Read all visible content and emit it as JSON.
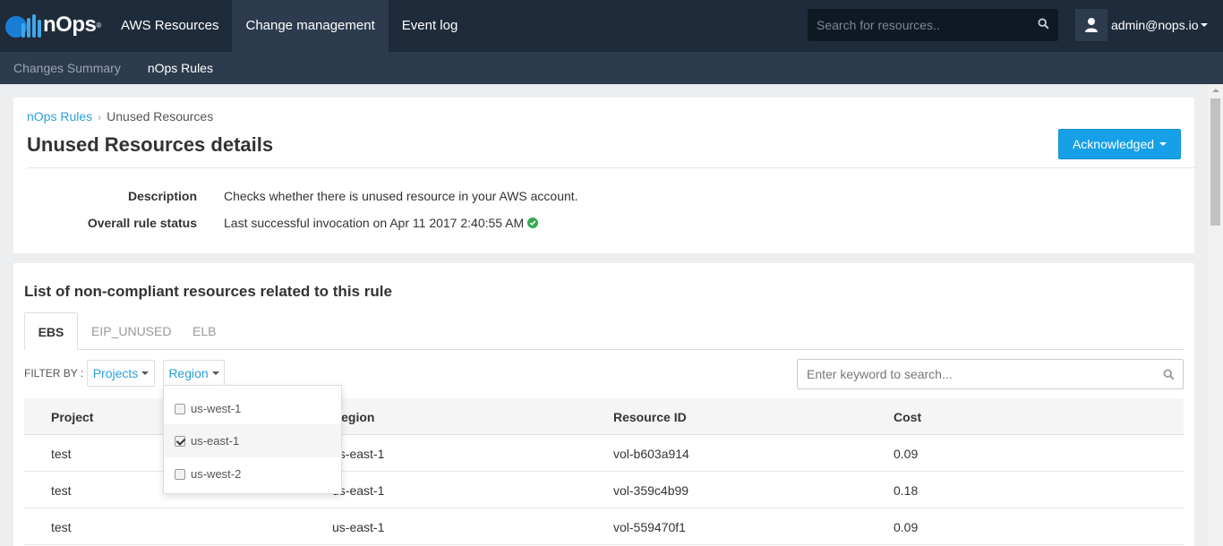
{
  "brand": {
    "name": "nOps",
    "mark": "®"
  },
  "topnav": {
    "items": [
      {
        "label": "AWS Resources",
        "active": false
      },
      {
        "label": "Change management",
        "active": true
      },
      {
        "label": "Event log",
        "active": false
      }
    ],
    "search_placeholder": "Search for resources..",
    "user": "admin@nops.io"
  },
  "subnav": {
    "items": [
      {
        "label": "Changes Summary",
        "active": false
      },
      {
        "label": "nOps Rules",
        "active": true
      }
    ]
  },
  "rule": {
    "breadcrumb_link": "nOps Rules",
    "breadcrumb_current": "Unused Resources",
    "title": "Unused Resources details",
    "status_button": "Acknowledged",
    "description_label": "Description",
    "description": "Checks whether there is unused resource in your AWS account.",
    "status_label": "Overall rule status",
    "status": "Last successful invocation on Apr 11 2017 2:40:55 AM"
  },
  "resources": {
    "title": "List of non-compliant resources related to this rule",
    "tabs": [
      {
        "label": "EBS",
        "active": true
      },
      {
        "label": "EIP_UNUSED",
        "active": false
      },
      {
        "label": "ELB",
        "active": false
      }
    ],
    "filter_label": "FILTER BY :",
    "filter_projects": "Projects",
    "filter_region": "Region",
    "search_placeholder": "Enter keyword to search...",
    "columns": [
      "Project",
      "Region",
      "Resource ID",
      "Cost"
    ],
    "rows": [
      {
        "project": "test",
        "region": "us-east-1",
        "resource_id": "vol-b603a914",
        "cost": "0.09"
      },
      {
        "project": "test",
        "region": "us-east-1",
        "resource_id": "vol-359c4b99",
        "cost": "0.18"
      },
      {
        "project": "test",
        "region": "us-east-1",
        "resource_id": "vol-559470f1",
        "cost": "0.09"
      }
    ],
    "region_options": [
      {
        "label": "us-west-1",
        "checked": false
      },
      {
        "label": "us-east-1",
        "checked": true
      },
      {
        "label": "us-west-2",
        "checked": false
      }
    ]
  },
  "colors": {
    "topbar": "#1e2b3a",
    "subbar": "#2c3b4d",
    "accent": "#16a0e8",
    "link": "#2a9fd6",
    "success": "#34a853"
  }
}
